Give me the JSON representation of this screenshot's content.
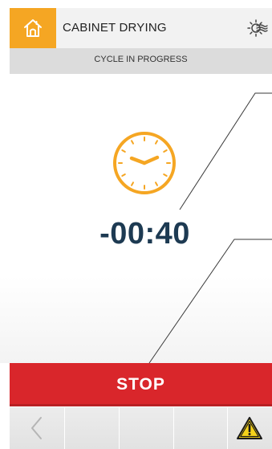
{
  "header": {
    "title": "CABINET DRYING",
    "home_icon": "home-icon",
    "mode_icon": "drying-fan-icon"
  },
  "status": {
    "text": "CYCLE IN PROGRESS"
  },
  "main": {
    "clock_icon": "clock-icon",
    "timer": "-00:40"
  },
  "actions": {
    "stop_label": "STOP"
  },
  "bottom_nav": {
    "back_icon": "chevron-left-icon",
    "warning_icon": "warning-icon"
  },
  "colors": {
    "accent": "#f5a623",
    "stop": "#d9262b",
    "timer_text": "#1d3a52",
    "warning": "#f5d21a"
  }
}
